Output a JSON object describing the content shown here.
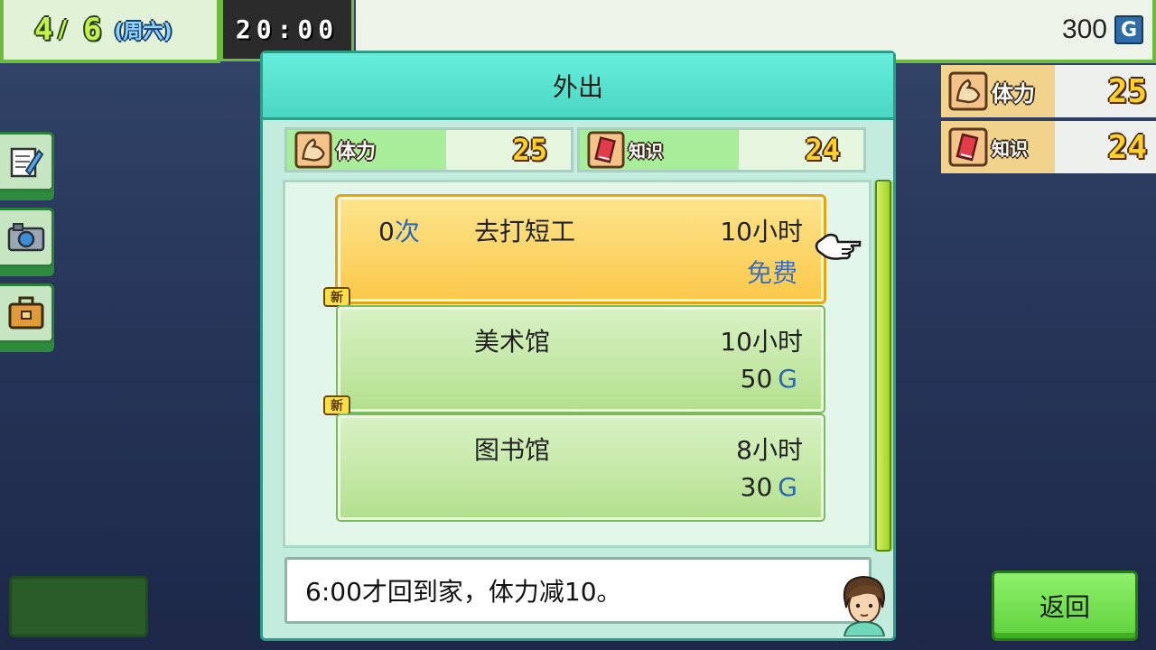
{
  "topbar": {
    "month": "4",
    "day": "6",
    "weekday": "(周六)",
    "clock": "20:00",
    "money": "300",
    "currency_icon": "G"
  },
  "stats_panel": {
    "stamina_label": "体力",
    "stamina_value": "25",
    "knowledge_label": "知识",
    "knowledge_value": "24"
  },
  "dialog": {
    "title": "外出",
    "stamina_label": "体力",
    "stamina_value": "25",
    "knowledge_label": "知识",
    "knowledge_value": "24",
    "options": [
      {
        "count": "0",
        "count_unit": "次",
        "name": "去打短工",
        "hours": "10小时",
        "cost": "免费",
        "selected": true
      },
      {
        "name": "美术馆",
        "hours": "10小时",
        "cost": "50",
        "cost_unit": "G",
        "new": true
      },
      {
        "name": "图书馆",
        "hours": "8小时",
        "cost": "30",
        "cost_unit": "G",
        "new": true
      }
    ],
    "new_tag": "新",
    "message": "6:00才回到家，体力减10。"
  },
  "buttons": {
    "back": "返回"
  },
  "icons": {
    "tools": [
      "notepad-icon",
      "camera-icon",
      "briefcase-icon"
    ],
    "cursor": "pointing-hand-icon"
  }
}
